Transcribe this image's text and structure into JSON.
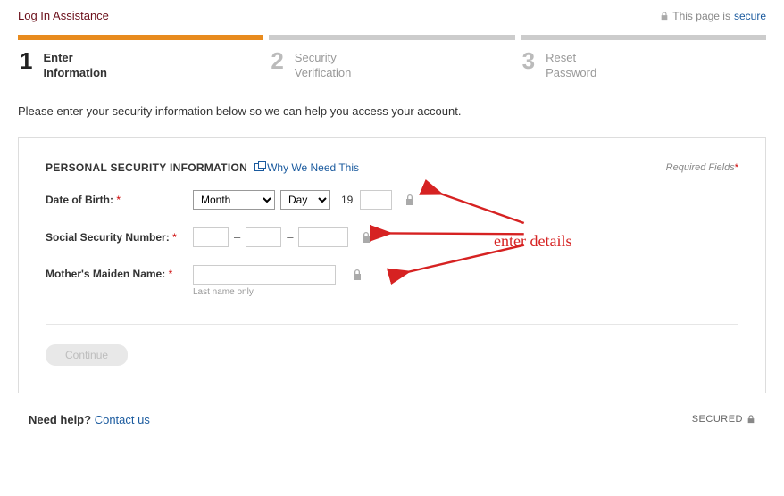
{
  "header": {
    "title": "Log In Assistance",
    "secure_prefix": "This page is ",
    "secure_link": "secure"
  },
  "steps": [
    {
      "num": "1",
      "label_line1": "Enter",
      "label_line2": "Information"
    },
    {
      "num": "2",
      "label_line1": "Security",
      "label_line2": "Verification"
    },
    {
      "num": "3",
      "label_line1": "Reset",
      "label_line2": "Password"
    }
  ],
  "intro": "Please enter your security information below so we can help you access your account.",
  "panel": {
    "title": "PERSONAL SECURITY INFORMATION",
    "why_link": "Why We Need This",
    "required_label": "Required Fields",
    "required_ast": "*"
  },
  "fields": {
    "dob": {
      "label": "Date of Birth:",
      "month_placeholder": "Month",
      "day_placeholder": "Day",
      "year_prefix": "19",
      "year_value": ""
    },
    "ssn": {
      "label": "Social Security Number:",
      "a": "",
      "b": "",
      "c": ""
    },
    "maiden": {
      "label": "Mother's Maiden Name:",
      "value": "",
      "helper": "Last name only"
    },
    "ast": "*",
    "dash": "–"
  },
  "actions": {
    "continue": "Continue"
  },
  "footer": {
    "need_help": "Need help?",
    "contact": "Contact us",
    "secured": "SECURED"
  },
  "annotation": {
    "text": "enter details"
  }
}
